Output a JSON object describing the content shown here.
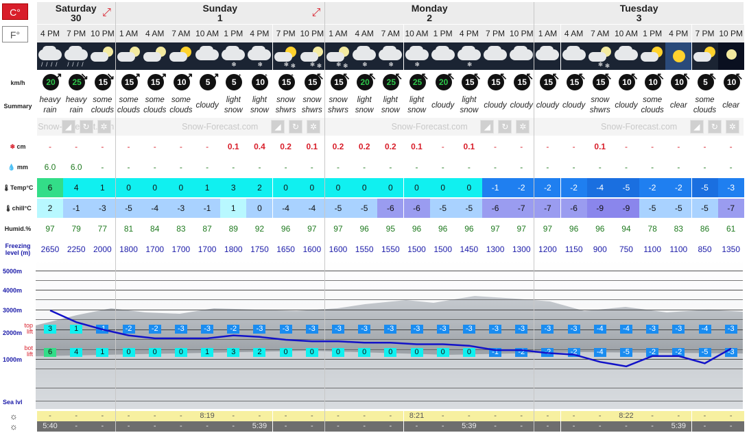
{
  "units": {
    "celsius": "C°",
    "fahrenheit": "F°"
  },
  "days": [
    {
      "name": "Saturday",
      "date": "30"
    },
    {
      "name": "Sunday",
      "date": "1"
    },
    {
      "name": "Monday",
      "date": "2"
    },
    {
      "name": "Tuesday",
      "date": "3"
    }
  ],
  "row_labels": {
    "wind": "km/h",
    "summary": "Summary",
    "snow": "cm",
    "rain": "mm",
    "temp": "Temp°C",
    "chill": "chill°C",
    "humid": "Humid.%",
    "freezing": "Freezing level (m)",
    "alt5000": "5000m",
    "alt4000": "4000m",
    "alt3000": "3000m",
    "alt2000": "2000m",
    "alt1000": "1000m",
    "sea": "Sea lvl",
    "top": "top lift",
    "bot": "bot lift"
  },
  "brand": "Snow-Forecast.com",
  "periods": [
    {
      "time": "4 PM",
      "wx": "heavy-rain",
      "wind": "20",
      "dir": "↗",
      "summary": "heavy rain",
      "snow": "-",
      "rain": "6.0",
      "temp": "6",
      "chill": "2",
      "humid": "97",
      "freeze": "2650"
    },
    {
      "time": "7 PM",
      "wx": "heavy-rain",
      "wind": "25",
      "dir": "↘",
      "summary": "heavy rain",
      "snow": "-",
      "rain": "6.0",
      "temp": "4",
      "chill": "-1",
      "humid": "79",
      "freeze": "2250"
    },
    {
      "time": "10 PM",
      "wx": "clouds-moon",
      "wind": "15",
      "dir": "↘",
      "summary": "some clouds",
      "snow": "-",
      "rain": "-",
      "temp": "1",
      "chill": "-3",
      "humid": "77",
      "freeze": "2000"
    },
    {
      "time": "1 AM",
      "wx": "clouds-moon",
      "wind": "15",
      "dir": "↗",
      "summary": "some clouds",
      "snow": "-",
      "rain": "-",
      "temp": "0",
      "chill": "-5",
      "humid": "81",
      "freeze": "1800"
    },
    {
      "time": "4 AM",
      "wx": "clouds-moon",
      "wind": "15",
      "dir": "↗",
      "summary": "some clouds",
      "snow": "-",
      "rain": "-",
      "temp": "0",
      "chill": "-4",
      "humid": "84",
      "freeze": "1700"
    },
    {
      "time": "7 AM",
      "wx": "clouds-sun",
      "wind": "10",
      "dir": "↗",
      "summary": "some clouds",
      "snow": "-",
      "rain": "-",
      "temp": "0",
      "chill": "-3",
      "humid": "83",
      "freeze": "1700"
    },
    {
      "time": "10 AM",
      "wx": "cloudy",
      "wind": "5",
      "dir": "↗",
      "summary": "cloudy",
      "snow": "-",
      "rain": "-",
      "temp": "1",
      "chill": "-1",
      "humid": "87",
      "freeze": "1700"
    },
    {
      "time": "1 PM",
      "wx": "light-snow",
      "wind": "5",
      "dir": "↑",
      "summary": "light snow",
      "snow": "0.1",
      "rain": "-",
      "temp": "3",
      "chill": "1",
      "humid": "89",
      "freeze": "1800"
    },
    {
      "time": "4 PM",
      "wx": "light-snow",
      "wind": "10",
      "dir": "↑",
      "summary": "light snow",
      "snow": "0.4",
      "rain": "-",
      "temp": "2",
      "chill": "0",
      "humid": "92",
      "freeze": "1750"
    },
    {
      "time": "7 PM",
      "wx": "snow-sun",
      "wind": "15",
      "dir": "↑",
      "summary": "snow shwrs",
      "snow": "0.2",
      "rain": "-",
      "temp": "0",
      "chill": "-4",
      "humid": "96",
      "freeze": "1650"
    },
    {
      "time": "10 PM",
      "wx": "snow-moon",
      "wind": "15",
      "dir": "↖",
      "summary": "snow shwrs",
      "snow": "0.1",
      "rain": "-",
      "temp": "0",
      "chill": "-4",
      "humid": "97",
      "freeze": "1600"
    },
    {
      "time": "1 AM",
      "wx": "snow-moon",
      "wind": "15",
      "dir": "↖",
      "summary": "snow shwrs",
      "snow": "0.2",
      "rain": "-",
      "temp": "0",
      "chill": "-5",
      "humid": "97",
      "freeze": "1600"
    },
    {
      "time": "4 AM",
      "wx": "light-snow",
      "wind": "20",
      "dir": "↖",
      "summary": "light snow",
      "snow": "0.2",
      "rain": "-",
      "temp": "0",
      "chill": "-5",
      "humid": "96",
      "freeze": "1550"
    },
    {
      "time": "7 AM",
      "wx": "light-snow",
      "wind": "25",
      "dir": "↖",
      "summary": "light snow",
      "snow": "0.2",
      "rain": "-",
      "temp": "0",
      "chill": "-6",
      "humid": "95",
      "freeze": "1550"
    },
    {
      "time": "10 AM",
      "wx": "light-snow",
      "wind": "25",
      "dir": "↖",
      "summary": "light snow",
      "snow": "0.1",
      "rain": "-",
      "temp": "0",
      "chill": "-6",
      "humid": "96",
      "freeze": "1500"
    },
    {
      "time": "1 PM",
      "wx": "cloudy",
      "wind": "20",
      "dir": "↖",
      "summary": "cloudy",
      "snow": "-",
      "rain": "-",
      "temp": "0",
      "chill": "-5",
      "humid": "96",
      "freeze": "1500"
    },
    {
      "time": "4 PM",
      "wx": "light-snow",
      "wind": "15",
      "dir": "↖",
      "summary": "light snow",
      "snow": "0.1",
      "rain": "-",
      "temp": "0",
      "chill": "-5",
      "humid": "96",
      "freeze": "1450"
    },
    {
      "time": "7 PM",
      "wx": "cloudy",
      "wind": "15",
      "dir": "↖",
      "summary": "cloudy",
      "snow": "-",
      "rain": "-",
      "temp": "-1",
      "chill": "-6",
      "humid": "97",
      "freeze": "1300"
    },
    {
      "time": "10 PM",
      "wx": "cloudy",
      "wind": "15",
      "dir": "↖",
      "summary": "cloudy",
      "snow": "-",
      "rain": "-",
      "temp": "-2",
      "chill": "-7",
      "humid": "97",
      "freeze": "1300"
    },
    {
      "time": "1 AM",
      "wx": "cloudy",
      "wind": "15",
      "dir": "↖",
      "summary": "cloudy",
      "snow": "-",
      "rain": "-",
      "temp": "-2",
      "chill": "-7",
      "humid": "97",
      "freeze": "1200"
    },
    {
      "time": "4 AM",
      "wx": "cloudy",
      "wind": "15",
      "dir": "↖",
      "summary": "cloudy",
      "snow": "-",
      "rain": "-",
      "temp": "-2",
      "chill": "-6",
      "humid": "96",
      "freeze": "1150"
    },
    {
      "time": "7 AM",
      "wx": "snow-moon",
      "wind": "15",
      "dir": "↖",
      "summary": "snow shwrs",
      "snow": "0.1",
      "rain": "-",
      "temp": "-4",
      "chill": "-9",
      "humid": "96",
      "freeze": "900"
    },
    {
      "time": "10 AM",
      "wx": "cloudy",
      "wind": "10",
      "dir": "↖",
      "summary": "cloudy",
      "snow": "-",
      "rain": "-",
      "temp": "-5",
      "chill": "-9",
      "humid": "94",
      "freeze": "750"
    },
    {
      "time": "1 PM",
      "wx": "clouds-sun",
      "wind": "10",
      "dir": "↖",
      "summary": "some clouds",
      "snow": "-",
      "rain": "-",
      "temp": "-2",
      "chill": "-5",
      "humid": "78",
      "freeze": "1100"
    },
    {
      "time": "4 PM",
      "wx": "sunny",
      "wind": "10",
      "dir": "↖",
      "summary": "clear",
      "snow": "-",
      "rain": "-",
      "temp": "-2",
      "chill": "-5",
      "humid": "83",
      "freeze": "1100"
    },
    {
      "time": "7 PM",
      "wx": "clouds-sun",
      "wind": "5",
      "dir": "↖",
      "summary": "some clouds",
      "snow": "-",
      "rain": "-",
      "temp": "-5",
      "chill": "-5",
      "humid": "86",
      "freeze": "850"
    },
    {
      "time": "10 PM",
      "wx": "clear-moon",
      "wind": "10",
      "dir": "↖",
      "summary": "clear",
      "snow": "-",
      "rain": "-",
      "temp": "-3",
      "chill": "-7",
      "humid": "61",
      "freeze": "1350"
    }
  ],
  "top_lift": [
    "3",
    "1",
    "-1",
    "-2",
    "-2",
    "-3",
    "-3",
    "-2",
    "-3",
    "-3",
    "-3",
    "-3",
    "-3",
    "-3",
    "-3",
    "-3",
    "-3",
    "-3",
    "-3",
    "-3",
    "-3",
    "-4",
    "-4",
    "-3",
    "-3",
    "-4",
    "-3"
  ],
  "bot_lift": [
    "6",
    "4",
    "1",
    "0",
    "0",
    "0",
    "1",
    "3",
    "2",
    "0",
    "0",
    "0",
    "0",
    "0",
    "0",
    "0",
    "0",
    "-1",
    "-2",
    "-2",
    "-2",
    "-4",
    "-5",
    "-2",
    "-2",
    "-5",
    "-3"
  ],
  "sunrise_row": [
    "-",
    "-",
    "-",
    "-",
    "-",
    "-",
    "8:19",
    "-",
    "-",
    "-",
    "-",
    "-",
    "-",
    "-",
    "8:21",
    "-",
    "-",
    "-",
    "-",
    "-",
    "-",
    "-",
    "8:22",
    "-",
    "-",
    "-",
    "-"
  ],
  "sunset_row": [
    "5:40",
    "-",
    "-",
    "-",
    "-",
    "-",
    "-",
    "-",
    "5:39",
    "-",
    "-",
    "-",
    "-",
    "-",
    "-",
    "-",
    "5:39",
    "-",
    "-",
    "-",
    "-",
    "-",
    "-",
    "-",
    "5:39",
    "-",
    "-"
  ]
}
